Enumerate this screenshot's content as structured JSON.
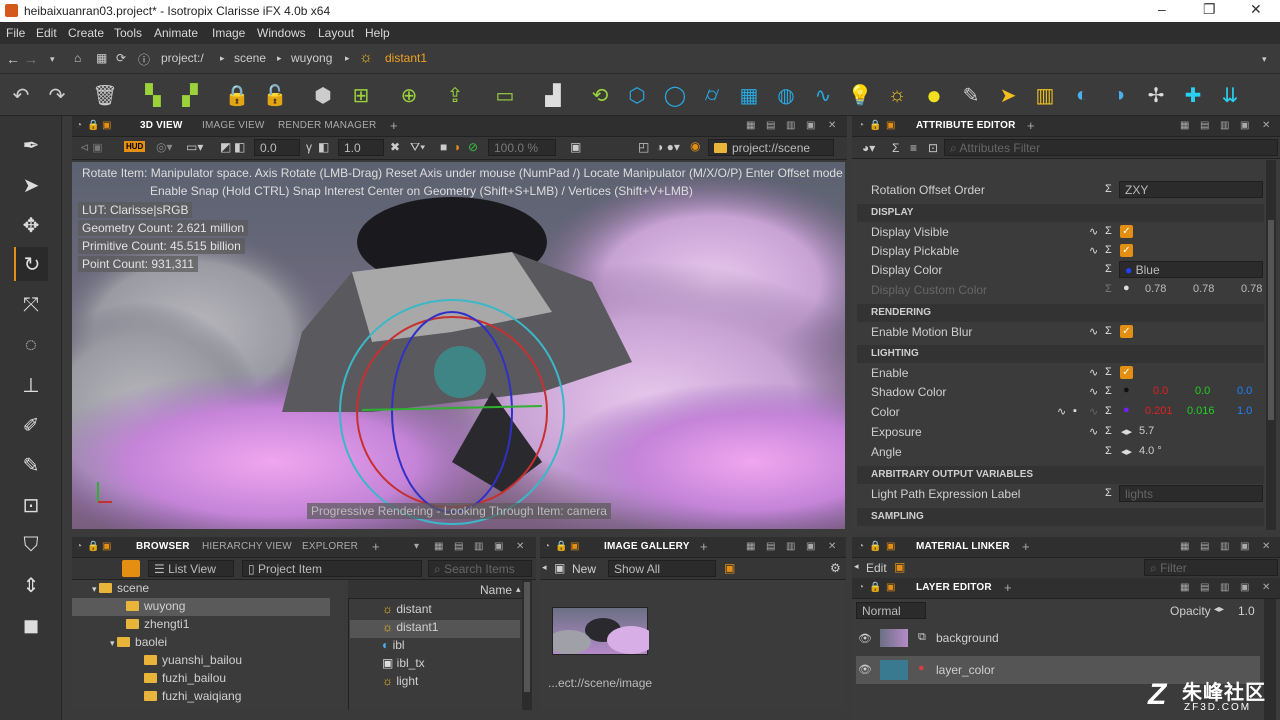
{
  "window": {
    "title": "heibaixuanran03.project* - Isotropix Clarisse iFX 4.0b x64"
  },
  "menu": [
    "File",
    "Edit",
    "Create",
    "Tools",
    "Animate",
    "Image",
    "Windows",
    "Layout",
    "Help"
  ],
  "path": {
    "root": "project:/",
    "items": [
      "scene",
      "wuyong"
    ],
    "current": "distant1"
  },
  "viewport": {
    "tabs": [
      "3D VIEW",
      "IMAGE VIEW",
      "RENDER MANAGER"
    ],
    "toolbar": {
      "hud": "HUD",
      "val1": "0.0",
      "val2": "1.0",
      "zoom": "100.0 %",
      "context": "project://scene"
    },
    "hint1": "Rotate Item: Manipulator space. Axis Rotate (LMB-Drag) Reset Axis under mouse (NumPad /)  Locate Manipulator (M/X/O/P)  Enter Offset mode",
    "hint2": "Enable Snap (Hold CTRL) Snap Interest Center on Geometry (Shift+S+LMB) / Vertices (Shift+V+LMB)",
    "lut": "LUT: Clarisse|sRGB",
    "geometry": "Geometry Count: 2.621 million",
    "primitive": "Primitive Count: 45.515 billion",
    "points": "Point Count: 931,311",
    "status": "Progressive Rendering - Looking Through Item: camera"
  },
  "attr": {
    "title": "ATTRIBUTE EDITOR",
    "filter": "Attributes Filter",
    "rotation_label": "Rotation Offset Order",
    "rotation_value": "ZXY",
    "sections": {
      "display": "DISPLAY",
      "rendering": "RENDERING",
      "lighting": "LIGHTING",
      "aov": "ARBITRARY OUTPUT VARIABLES",
      "sampling": "SAMPLING"
    },
    "display_visible": "Display Visible",
    "display_pickable": "Display Pickable",
    "display_color": "Display Color",
    "display_color_val": "Blue",
    "custom_color": "Display Custom Color",
    "custom": [
      "0.78",
      "0.78",
      "0.78"
    ],
    "motion_blur": "Enable Motion Blur",
    "enable": "Enable",
    "shadow_color": "Shadow Color",
    "shadow": [
      "0.0",
      "0.0",
      "0.0"
    ],
    "color": "Color",
    "color_vals": [
      "0.201",
      "0.016",
      "1.0"
    ],
    "exposure": "Exposure",
    "exposure_val": "5.7",
    "angle": "Angle",
    "angle_val": "4.0 °",
    "lpe": "Light Path Expression Label",
    "lpe_val": "lights"
  },
  "browser": {
    "tabs": [
      "BROWSER",
      "HIERARCHY VIEW",
      "EXPLORER"
    ],
    "list_view": "List View",
    "project_item": "Project Item",
    "search": "Search Items",
    "tree": [
      "scene",
      "wuyong",
      "zhengti1",
      "baolei",
      "yuanshi_bailou",
      "fuzhi_bailou",
      "fuzhi_waiqiang"
    ],
    "name_header": "Name",
    "items": [
      "distant",
      "distant1",
      "ibl",
      "ibl_tx",
      "light"
    ]
  },
  "gallery": {
    "title": "IMAGE GALLERY",
    "new": "New",
    "show": "Show All",
    "path": "...ect://scene/image"
  },
  "material": {
    "title": "MATERIAL LINKER",
    "edit": "Edit",
    "filter": "Filter"
  },
  "layer": {
    "title": "LAYER EDITOR",
    "blend": "Normal",
    "opacity_label": "Opacity",
    "opacity": "1.0",
    "layers": [
      "background",
      "layer_color"
    ]
  },
  "watermark": {
    "cn": "朱峰社区",
    "url": "ZF3D.COM"
  }
}
